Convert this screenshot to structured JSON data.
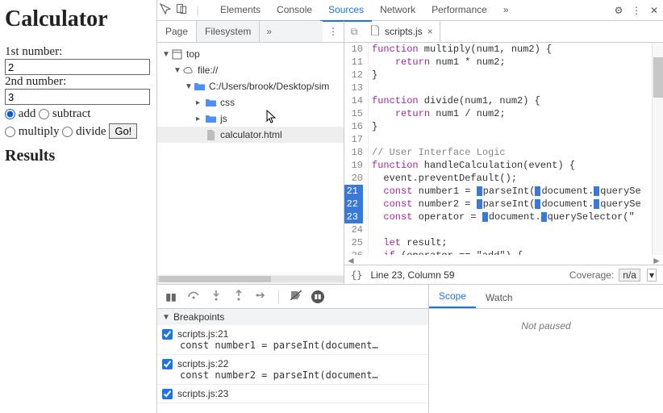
{
  "page": {
    "heading": "Calculator",
    "label_num1": "1st number:",
    "value_num1": "2",
    "label_num2": "2nd number:",
    "value_num2": "3",
    "radio_add": "add",
    "radio_subtract": "subtract",
    "radio_multiply": "multiply",
    "radio_divide": "divide",
    "go_label": "Go!",
    "results_heading": "Results"
  },
  "devtools": {
    "top_tabs": [
      "Elements",
      "Console",
      "Sources",
      "Network",
      "Performance"
    ],
    "top_active": 2,
    "side_tabs": {
      "page": "Page",
      "filesystem": "Filesystem"
    },
    "file_tree": {
      "top": "top",
      "file_scheme": "file://",
      "path": "C:/Users/brook/Desktop/sim",
      "folder_css": "css",
      "folder_js": "js",
      "file_html": "calculator.html"
    },
    "open_file": "scripts.js",
    "code_start_line": 10,
    "code_lines": [
      "function multiply(num1, num2) {",
      "    return num1 * num2;",
      "}",
      "",
      "function divide(num1, num2) {",
      "    return num1 / num2;",
      "}",
      "",
      "// User Interface Logic",
      "function handleCalculation(event) {",
      "  event.preventDefault();",
      "  const number1 = parseInt(document.querySe",
      "  const number2 = parseInt(document.querySe",
      "  const operator = document.querySelector(\"",
      "",
      "  let result;",
      "  if (operator == \"add\") {"
    ],
    "breakpoint_lines": [
      21,
      22,
      23
    ],
    "status": {
      "cursor": "Line 23, Column 59",
      "coverage": "Coverage:",
      "coverage_val": "n/a"
    },
    "breakpoints_header": "Breakpoints",
    "breakpoints": [
      {
        "file": "scripts.js:21",
        "snippet": "  const number1 = parseInt(document…"
      },
      {
        "file": "scripts.js:22",
        "snippet": "  const number2 = parseInt(document…"
      },
      {
        "file": "scripts.js:23",
        "snippet": ""
      }
    ],
    "scope_tab": "Scope",
    "watch_tab": "Watch",
    "not_paused": "Not paused"
  }
}
